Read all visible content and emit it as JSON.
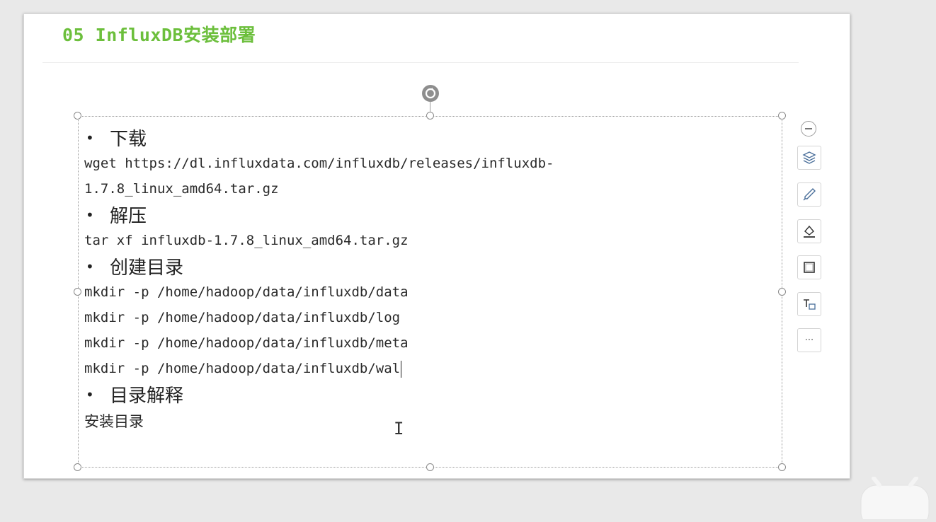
{
  "slide": {
    "title": "05 InfluxDB安装部署"
  },
  "content": {
    "bullet_download": "下载",
    "download_cmd_line1": "wget https://dl.influxdata.com/influxdb/releases/influxdb-",
    "download_cmd_line2": "1.7.8_linux_amd64.tar.gz",
    "bullet_extract": "解压",
    "extract_cmd": "tar xf influxdb-1.7.8_linux_amd64.tar.gz",
    "bullet_mkdir": "创建目录",
    "mkdir_cmds": [
      "mkdir -p /home/hadoop/data/influxdb/data",
      "mkdir -p /home/hadoop/data/influxdb/log",
      "mkdir -p /home/hadoop/data/influxdb/meta",
      "mkdir -p /home/hadoop/data/influxdb/wal"
    ],
    "bullet_explain": "目录解释",
    "explain_text": "安装目录"
  },
  "bullet_symbol": "•",
  "colors": {
    "title": "#6cbf3c",
    "background": "#e9e9e9",
    "slide": "#ffffff"
  },
  "side_toolbar": {
    "icons": [
      "collapse-icon",
      "layers-icon",
      "brush-icon",
      "fill-icon",
      "border-icon",
      "text-box-icon",
      "more-icon"
    ],
    "more_label": "···"
  }
}
